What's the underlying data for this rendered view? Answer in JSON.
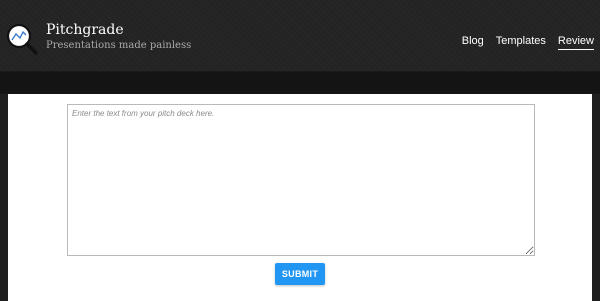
{
  "brand": {
    "title": "Pitchgrade",
    "tagline": "Presentations made painless",
    "logo_icon": "magnifier-chart-icon"
  },
  "nav": {
    "items": [
      {
        "label": "Blog",
        "active": false
      },
      {
        "label": "Templates",
        "active": false
      },
      {
        "label": "Review",
        "active": true
      }
    ]
  },
  "form": {
    "placeholder": "Enter the text from your pitch deck here.",
    "value": "",
    "submit_label": "SUBMIT"
  },
  "colors": {
    "accent": "#2196f3",
    "header_bg": "#232323",
    "panel_bg": "#ffffff"
  }
}
